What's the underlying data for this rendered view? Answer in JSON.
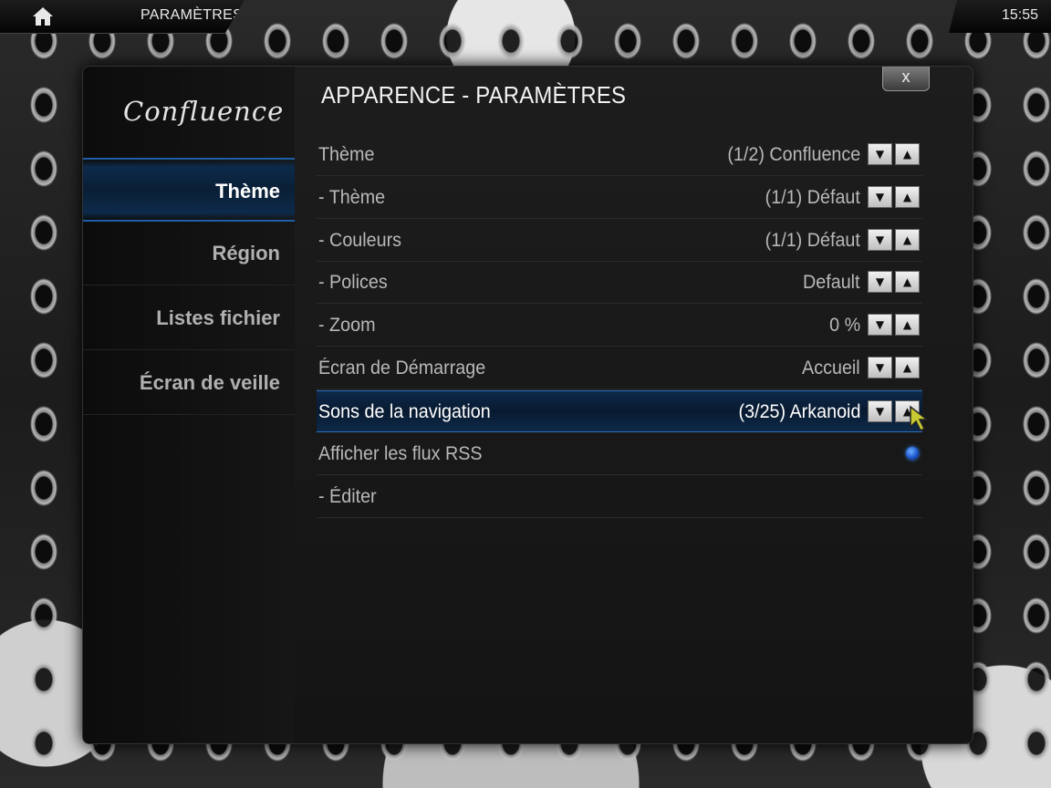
{
  "topbar": {
    "breadcrumb": "PARAMÈTRES",
    "clock": "15:55"
  },
  "dialog": {
    "logo": "Confluence",
    "title": "APPARENCE - PARAMÈTRES",
    "close_label": "x",
    "sidebar": [
      {
        "label": "Thème",
        "active": true
      },
      {
        "label": "Région",
        "active": false
      },
      {
        "label": "Listes fichier",
        "active": false
      },
      {
        "label": "Écran de veille",
        "active": false
      }
    ],
    "settings": [
      {
        "label": "Thème",
        "value": "(1/2) Confluence",
        "control": "spinner"
      },
      {
        "label": "- Thème",
        "value": "(1/1) Défaut",
        "control": "spinner"
      },
      {
        "label": "- Couleurs",
        "value": "(1/1) Défaut",
        "control": "spinner"
      },
      {
        "label": "- Polices",
        "value": "Default",
        "control": "spinner"
      },
      {
        "label": "- Zoom",
        "value": "0 %",
        "control": "spinner"
      },
      {
        "label": "Écran de Démarrage",
        "value": "Accueil",
        "control": "spinner"
      },
      {
        "label": "Sons de la navigation",
        "value": "(3/25) Arkanoid",
        "control": "spinner",
        "focused": true
      },
      {
        "label": "Afficher les flux RSS",
        "value": "",
        "control": "radio",
        "checked": true
      },
      {
        "label": "- Éditer",
        "value": "",
        "control": "none"
      }
    ]
  },
  "icons": {
    "home": "home-icon",
    "spin_down": "▼",
    "spin_up": "▲"
  },
  "colors": {
    "accent": "#1e5fa8",
    "focus_bg": "#0e2a4a",
    "text": "#b8b8b8",
    "text_active": "#ffffff"
  }
}
